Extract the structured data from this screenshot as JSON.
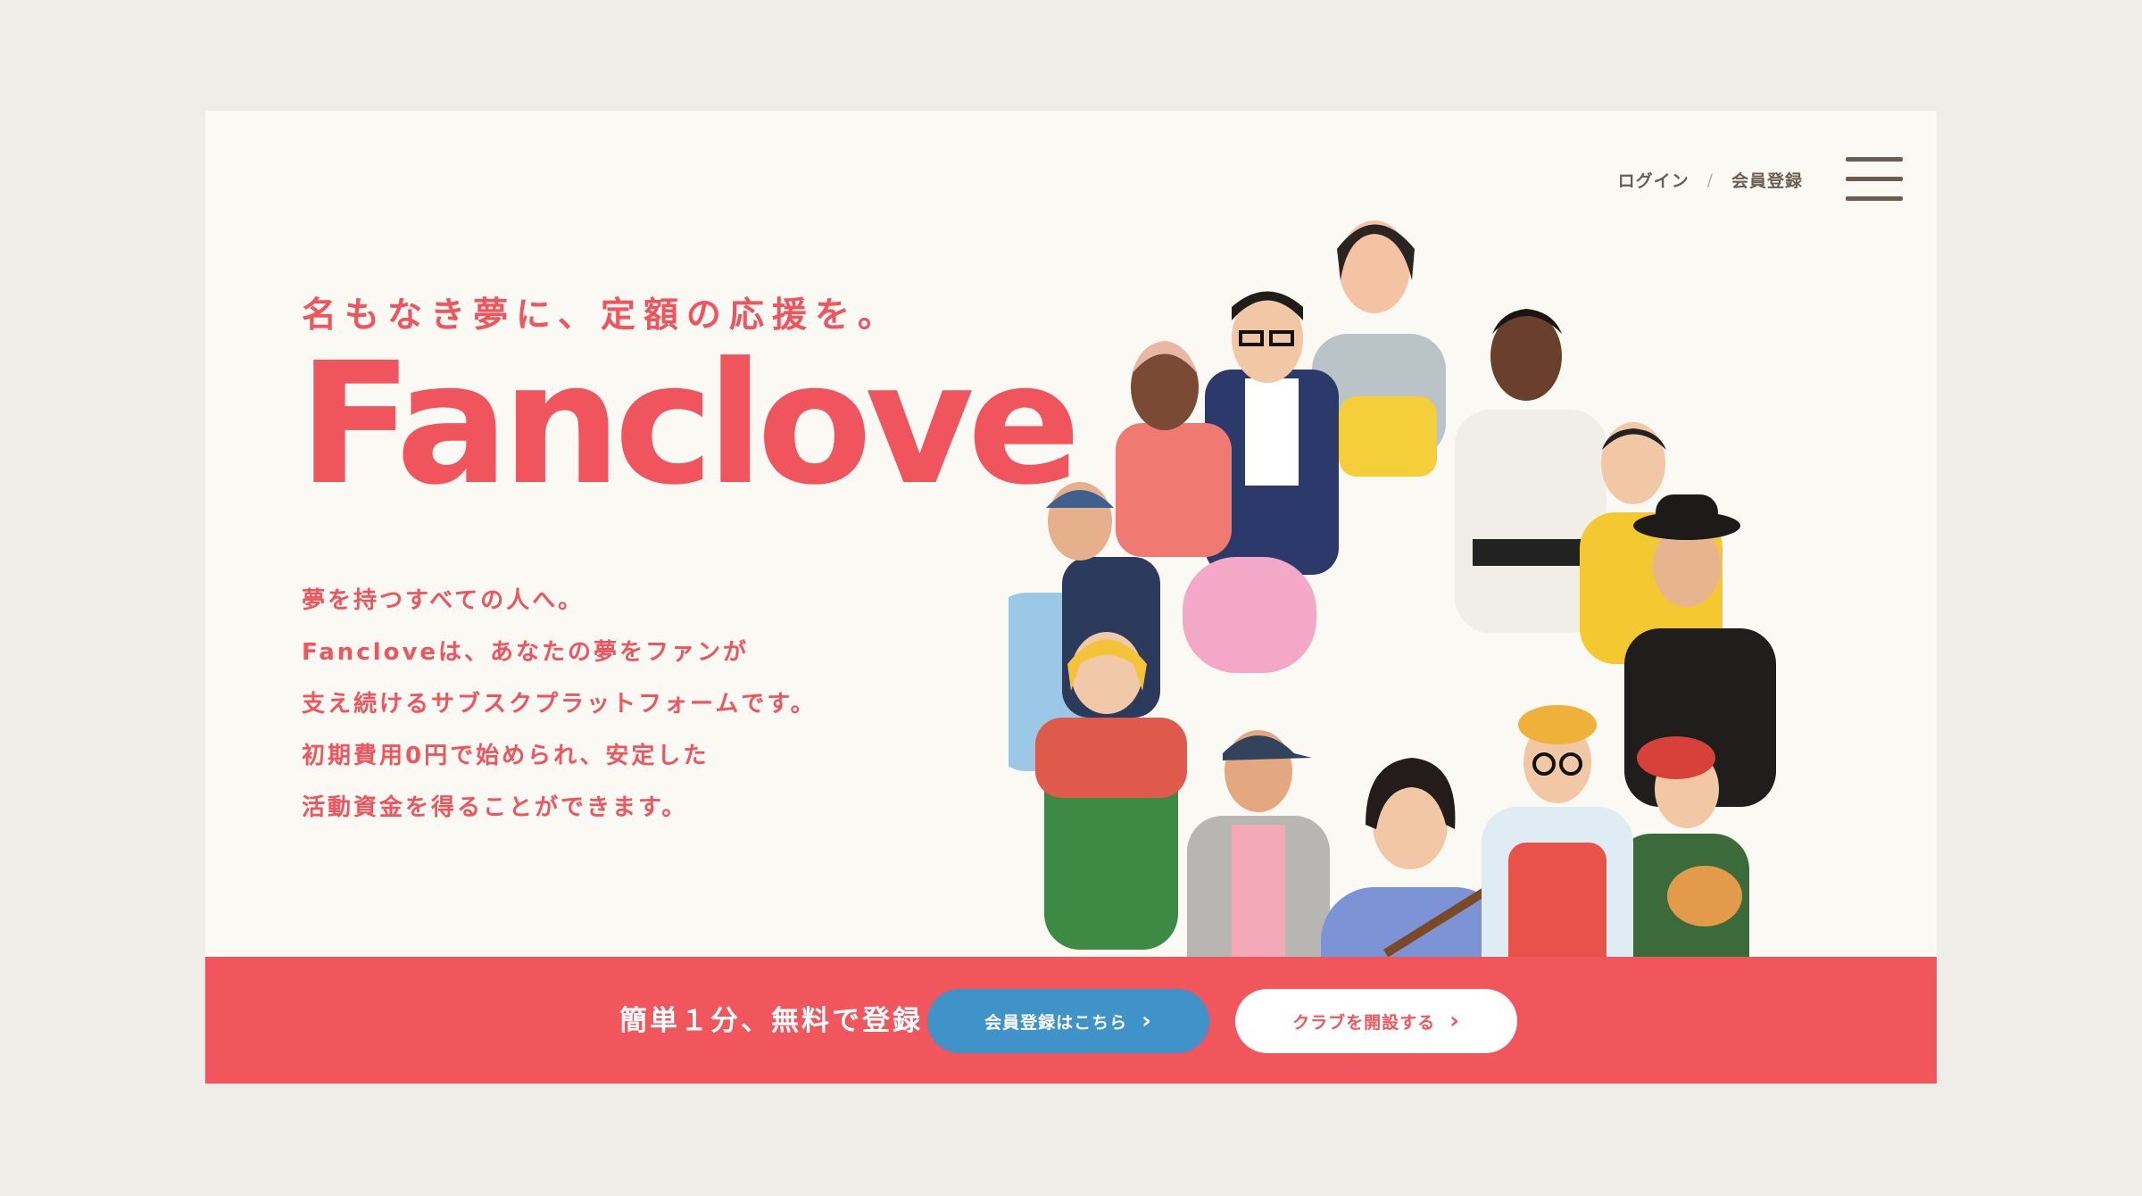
{
  "header": {
    "login_label": "ログイン",
    "separator": "/",
    "register_label": "会員登録",
    "menu_icon": "hamburger-menu-icon"
  },
  "hero": {
    "catchcopy": "名もなき夢に、定額の応援を。",
    "logo_text": "Fanclove",
    "description": [
      "夢を持つすべての人へ。",
      "Fancloveは、あなたの夢をファンが",
      "支え続けるサブスクプラットフォームです。",
      "初期費用0円で始められ、安定した",
      "活動資金を得ることができます。"
    ]
  },
  "cta": {
    "text": "簡単１分、無料で登録",
    "member_button": "会員登録はこちら",
    "club_button": "クラブを開設する",
    "chevron": "›"
  },
  "colors": {
    "brand": "#f0555e",
    "blue": "#3f93c9",
    "background": "#fbf9f3",
    "outer": "#eeede8",
    "nav_text": "#6b5d52"
  }
}
